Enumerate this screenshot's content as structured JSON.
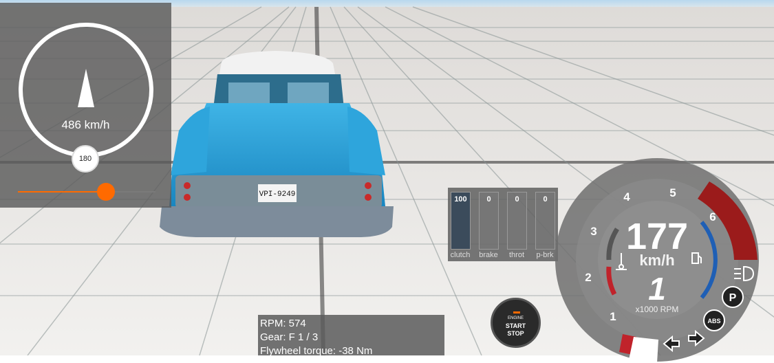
{
  "navigation": {
    "speed_readout": "486 km/h",
    "heading_marker": "180",
    "slider_level": 0.64
  },
  "inputs_panel": {
    "bars": [
      {
        "label": "clutch",
        "value": "100",
        "level": 1.0
      },
      {
        "label": "brake",
        "value": "0",
        "level": 0
      },
      {
        "label": "throt",
        "value": "0",
        "level": 0
      },
      {
        "label": "p-brk",
        "value": "0",
        "level": 0
      }
    ]
  },
  "telemetry": {
    "rpm": "RPM: 574",
    "gear": "Gear: F 1 / 3",
    "torque": "Flywheel torque: -38 Nm"
  },
  "engine_button": {
    "line1": "ENGINE",
    "line2": "START",
    "line3": "STOP"
  },
  "dashboard": {
    "speed": "177",
    "speed_unit": "km/h",
    "gear": "1",
    "rpm_unit": "x1000 RPM",
    "rpm_ticks": [
      "1",
      "2",
      "3",
      "4",
      "5",
      "6"
    ],
    "abs_label": "ABS",
    "park_label": "P",
    "colors": {
      "redline": "#9b1b1b",
      "fuel_arc": "#1f5fb5",
      "temp_arc": "#c0232b"
    }
  },
  "vehicle": {
    "plate": "VPI-9249",
    "body_color": "#2aa0d8"
  }
}
